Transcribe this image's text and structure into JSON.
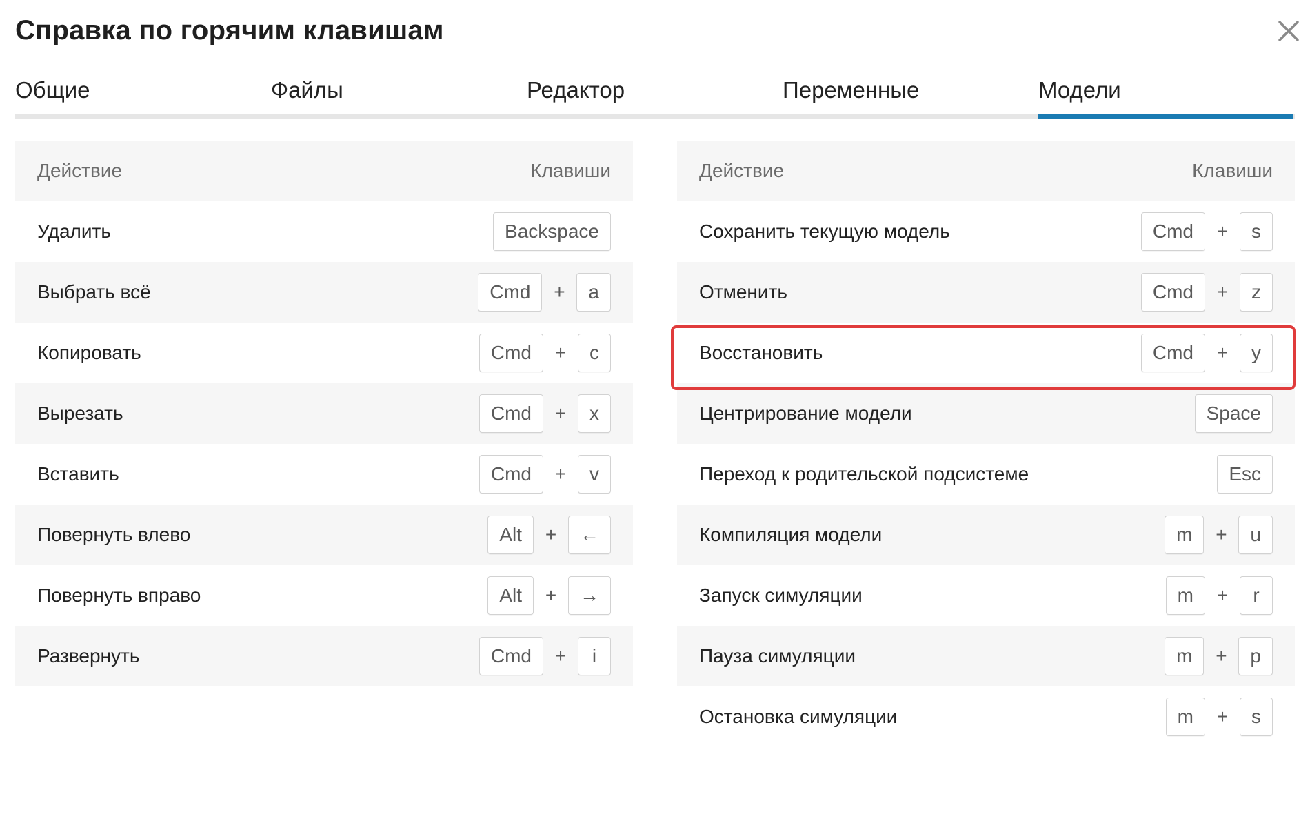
{
  "dialog": {
    "title": "Справка по горячим клавишам",
    "close_icon": "close-icon"
  },
  "tabs": [
    {
      "label": "Общие",
      "active": false
    },
    {
      "label": "Файлы",
      "active": false
    },
    {
      "label": "Редактор",
      "active": false
    },
    {
      "label": "Переменные",
      "active": false
    },
    {
      "label": "Модели",
      "active": true
    }
  ],
  "colors": {
    "accent": "#1a7bb3",
    "highlight": "#e03b3b",
    "row_shade": "#f6f6f6"
  },
  "left_table": {
    "header": {
      "action": "Действие",
      "keys": "Клавиши"
    },
    "rows": [
      {
        "action": "Удалить",
        "keys": [
          "Backspace"
        ]
      },
      {
        "action": "Выбрать всё",
        "keys": [
          "Cmd",
          "a"
        ]
      },
      {
        "action": "Копировать",
        "keys": [
          "Cmd",
          "c"
        ]
      },
      {
        "action": "Вырезать",
        "keys": [
          "Cmd",
          "x"
        ]
      },
      {
        "action": "Вставить",
        "keys": [
          "Cmd",
          "v"
        ]
      },
      {
        "action": "Повернуть влево",
        "keys": [
          "Alt",
          "←"
        ]
      },
      {
        "action": "Повернуть вправо",
        "keys": [
          "Alt",
          "→"
        ]
      },
      {
        "action": "Развернуть",
        "keys": [
          "Cmd",
          "i"
        ]
      }
    ],
    "plus_sign": "+"
  },
  "right_table": {
    "header": {
      "action": "Действие",
      "keys": "Клавиши"
    },
    "rows": [
      {
        "action": "Сохранить текущую модель",
        "keys": [
          "Cmd",
          "s"
        ]
      },
      {
        "action": "Отменить",
        "keys": [
          "Cmd",
          "z"
        ]
      },
      {
        "action": "Восстановить",
        "keys": [
          "Cmd",
          "y"
        ]
      },
      {
        "action": "Центрирование модели",
        "keys": [
          "Space"
        ]
      },
      {
        "action": "Переход к родительской подсистеме",
        "keys": [
          "Esc"
        ]
      },
      {
        "action": "Компиляция модели",
        "keys": [
          "m",
          "u"
        ]
      },
      {
        "action": "Запуск симуляции",
        "keys": [
          "m",
          "r"
        ]
      },
      {
        "action": "Пауза симуляции",
        "keys": [
          "m",
          "p"
        ]
      },
      {
        "action": "Остановка симуляции",
        "keys": [
          "m",
          "s"
        ]
      }
    ],
    "plus_sign": "+"
  }
}
